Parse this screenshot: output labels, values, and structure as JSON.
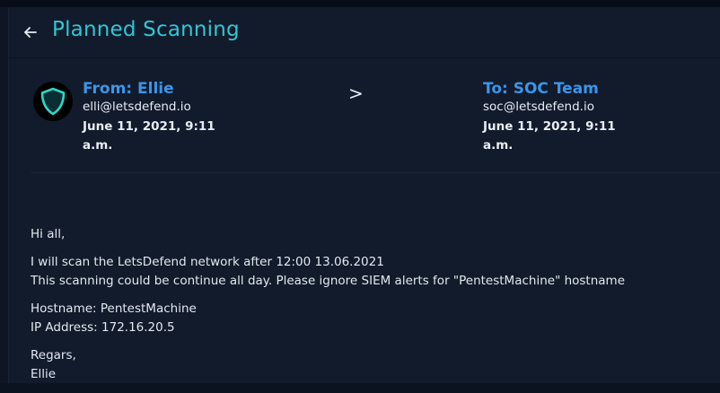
{
  "header": {
    "back_icon": "arrow-left-icon",
    "title": "Planned Scanning"
  },
  "sender": {
    "avatar_icon": "shield-icon",
    "label": "From: Ellie",
    "email": "elli@letsdefend.io",
    "date_line1": "June 11, 2021, 9:11",
    "date_line2": "a.m."
  },
  "separator": ">",
  "recipient": {
    "label": "To: SOC Team",
    "email": "soc@letsdefend.io",
    "date_line1": "June 11, 2021, 9:11",
    "date_line2": "a.m."
  },
  "message": {
    "greeting": "Hi all,",
    "line1": "I will scan the LetsDefend network after 12:00 13.06.2021",
    "line2": "This scanning could be continue all day. Please ignore SIEM alerts for \"PentestMachine\" hostname",
    "hostname": "Hostname: PentestMachine",
    "ip": "IP Address: 172.16.20.5",
    "closing": "Regars,",
    "signature": "Ellie"
  },
  "colors": {
    "accent_title": "#2fc7d6",
    "accent_names": "#3b95e9",
    "background": "#121b2b"
  }
}
